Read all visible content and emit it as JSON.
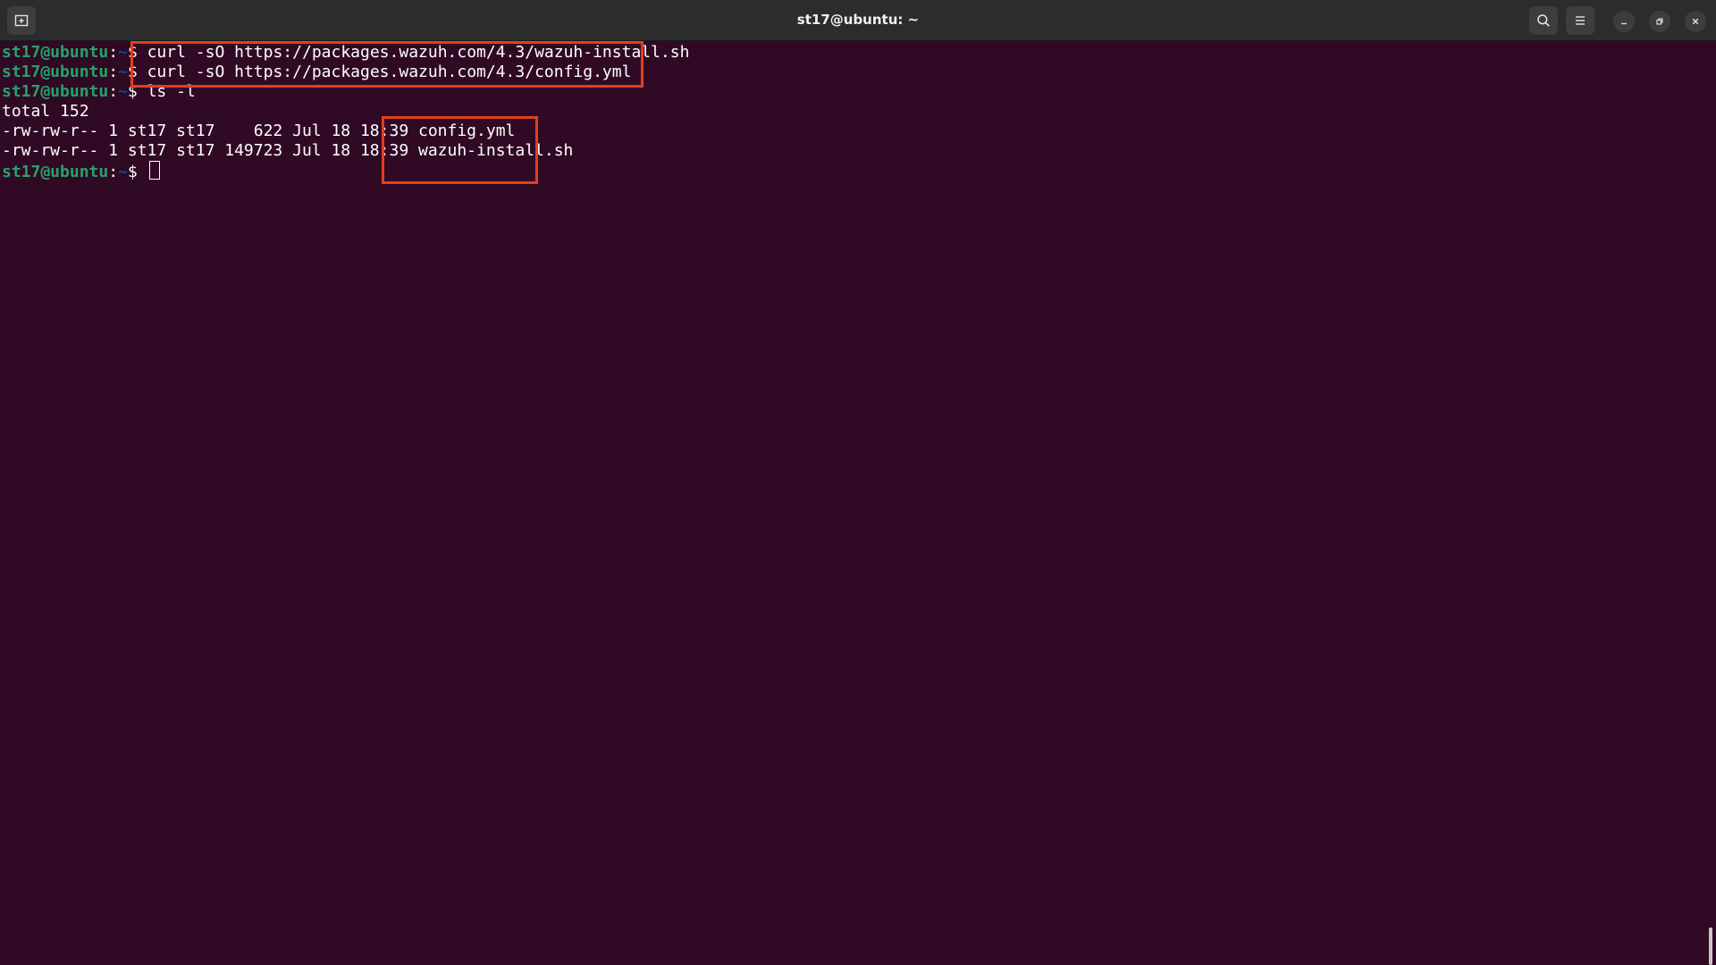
{
  "window": {
    "title": "st17@ubuntu: ~"
  },
  "prompt": {
    "user_host": "st17@ubuntu",
    "separator": ":",
    "path": "~",
    "symbol": "$ "
  },
  "terminal": {
    "commands": [
      "curl -sO https://packages.wazuh.com/4.3/wazuh-install.sh",
      "curl -sO https://packages.wazuh.com/4.3/config.yml",
      "ls -l"
    ],
    "total_line": "total 152",
    "files": [
      {
        "prefix": "-rw-rw-r-- 1 st17 st17    622 Jul 18 18:39 ",
        "name": "config.yml"
      },
      {
        "prefix": "-rw-rw-r-- 1 st17 st17 149723 Jul 18 18:39 ",
        "name": "wazuh-install.sh"
      }
    ]
  },
  "icons": {
    "new_tab": "new-tab-icon",
    "search": "search-icon",
    "menu": "hamburger-menu-icon",
    "minimize": "minimize-icon",
    "maximize": "restore-icon",
    "close": "close-icon"
  },
  "colors": {
    "background": "#300a24",
    "prompt_user": "#26a269",
    "prompt_path": "#12488b",
    "highlight": "#e2401c"
  }
}
